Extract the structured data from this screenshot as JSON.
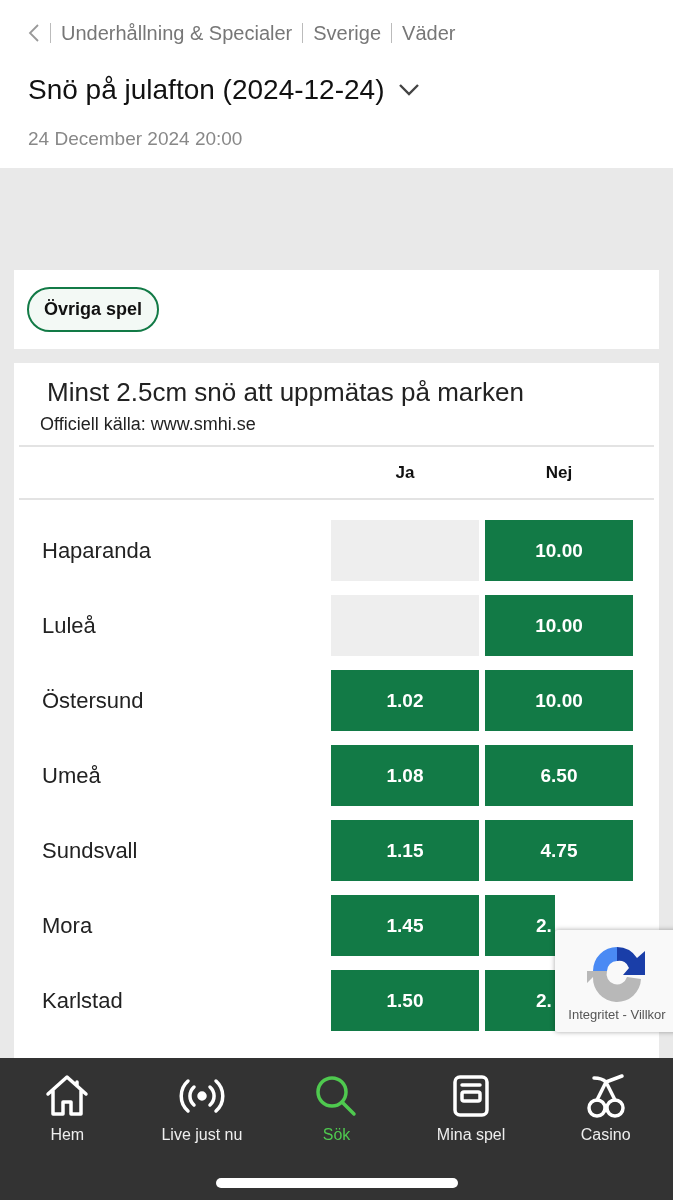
{
  "breadcrumb": [
    "Underhållning & Specialer",
    "Sverige",
    "Väder"
  ],
  "event": {
    "title": "Snö på julafton (2024-12-24)",
    "date": "24 December 2024 20:00"
  },
  "filters": [
    {
      "label": "Övriga spel",
      "selected": true
    }
  ],
  "market": {
    "title": "Minst 2.5cm snö att uppmätas på marken",
    "source": "Officiell källa: www.smhi.se",
    "columns": [
      "Ja",
      "Nej"
    ],
    "rows": [
      {
        "name": "Haparanda",
        "nej": "10.00",
        "nej_covered": false
      },
      {
        "name": "Luleå",
        "nej": "10.00",
        "nej_covered": false
      },
      {
        "name": "Östersund",
        "ja": "1.02",
        "nej": "10.00",
        "nej_covered": false
      },
      {
        "name": "Umeå",
        "ja": "1.08",
        "nej": "6.50",
        "nej_covered": false
      },
      {
        "name": "Sundsvall",
        "ja": "1.15",
        "nej": "4.75",
        "nej_covered": false
      },
      {
        "name": "Mora",
        "ja": "1.45",
        "nej": "2.",
        "nej_covered": true
      },
      {
        "name": "Karlstad",
        "ja": "1.50",
        "nej": "2.",
        "nej_covered": true
      }
    ]
  },
  "recaptcha": {
    "links": "Integritet - Villkor"
  },
  "nav": [
    {
      "label": "Hem",
      "kind": "home",
      "selected": false
    },
    {
      "label": "Live just nu",
      "kind": "live",
      "selected": false
    },
    {
      "label": "Sök",
      "kind": "search",
      "selected": true
    },
    {
      "label": "Mina spel",
      "kind": "bets",
      "selected": false
    },
    {
      "label": "Casino",
      "kind": "casino",
      "selected": false
    }
  ]
}
